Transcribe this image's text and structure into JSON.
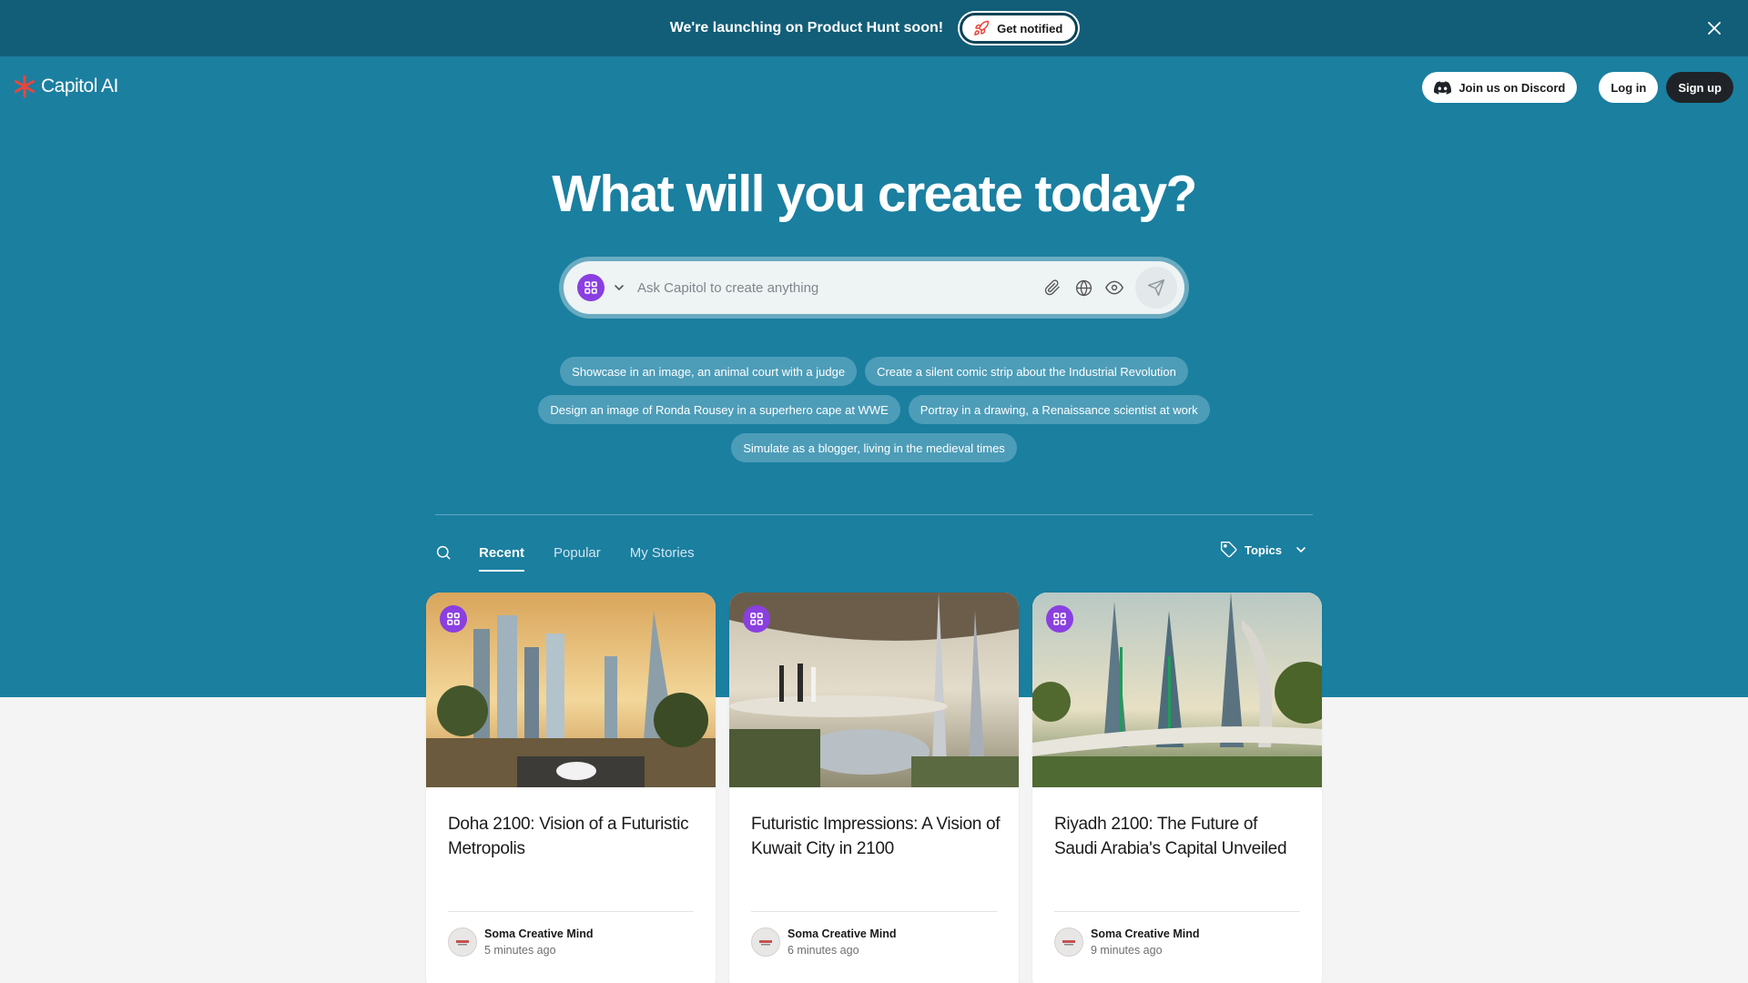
{
  "announcement": {
    "text": "We're launching on Product Hunt soon!",
    "button_label": "Get notified",
    "close_icon": "close-icon"
  },
  "brand": {
    "name": "Capitol AI",
    "accent": "#e8463c"
  },
  "nav": {
    "discord_label": "Join us on Discord",
    "login_label": "Log in",
    "signup_label": "Sign up"
  },
  "hero": {
    "headline": "What will you create today?",
    "search_placeholder": "Ask Capitol to create anything"
  },
  "suggestions": {
    "row1": [
      "Showcase in an image, an animal court with a judge",
      "Create a silent comic strip about the Industrial Revolution"
    ],
    "row2": [
      "Design an image of Ronda Rousey in a superhero cape at WWE",
      "Portray in a drawing, a Renaissance scientist at work"
    ],
    "row3": [
      "Simulate as a blogger, living in the medieval times"
    ]
  },
  "tabs": {
    "recent": "Recent",
    "popular": "Popular",
    "my_stories": "My Stories",
    "topics_label": "Topics"
  },
  "cards": [
    {
      "title": "Doha 2100: Vision of a Futuristic Metropolis",
      "author": "Soma Creative Mind",
      "time": "5 minutes ago"
    },
    {
      "title": "Futuristic Impressions: A Vision of Kuwait City in 2100",
      "author": "Soma Creative Mind",
      "time": "6 minutes ago"
    },
    {
      "title": "Riyadh 2100: The Future of Saudi Arabia's Capital Unveiled",
      "author": "Soma Creative Mind",
      "time": "9 minutes ago"
    }
  ],
  "colors": {
    "announce_bg": "#125e78",
    "hero_bg": "#1b7fa0",
    "app_icon": "#8a3fe0"
  }
}
